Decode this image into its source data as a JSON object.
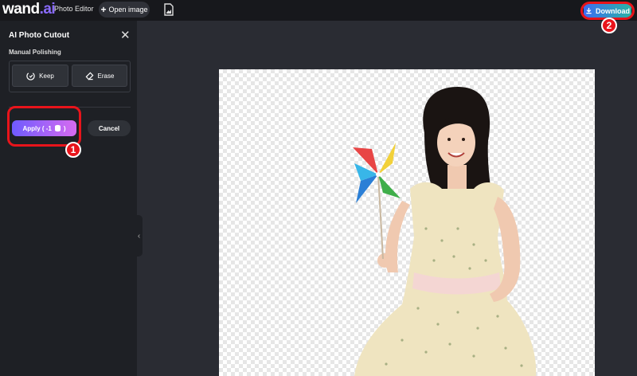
{
  "app": {
    "logo_main": "wand",
    "logo_suffix": ".ai",
    "nav_photo_editor": "Photo Editor",
    "open_image_label": "Open image",
    "download_label": "Download"
  },
  "panel": {
    "title": "AI Photo Cutout",
    "section_label": "Manual Polishing",
    "keep_label": "Keep",
    "erase_label": "Erase",
    "apply_label": "Apply ( -1",
    "apply_suffix": ")",
    "cancel_label": "Cancel"
  },
  "annotations": {
    "step_1": "1",
    "step_2": "2"
  },
  "colors": {
    "accent_red": "#e8141b",
    "apply_gradient_start": "#6e5bff",
    "apply_gradient_end": "#d76bf0",
    "download_gradient_start": "#3d6df2",
    "download_gradient_end": "#2bb3a5"
  },
  "icons": [
    "plus-icon",
    "file-image-icon",
    "download-icon",
    "close-icon",
    "keep-icon",
    "erase-icon",
    "credit-icon",
    "chevron-left-icon"
  ]
}
